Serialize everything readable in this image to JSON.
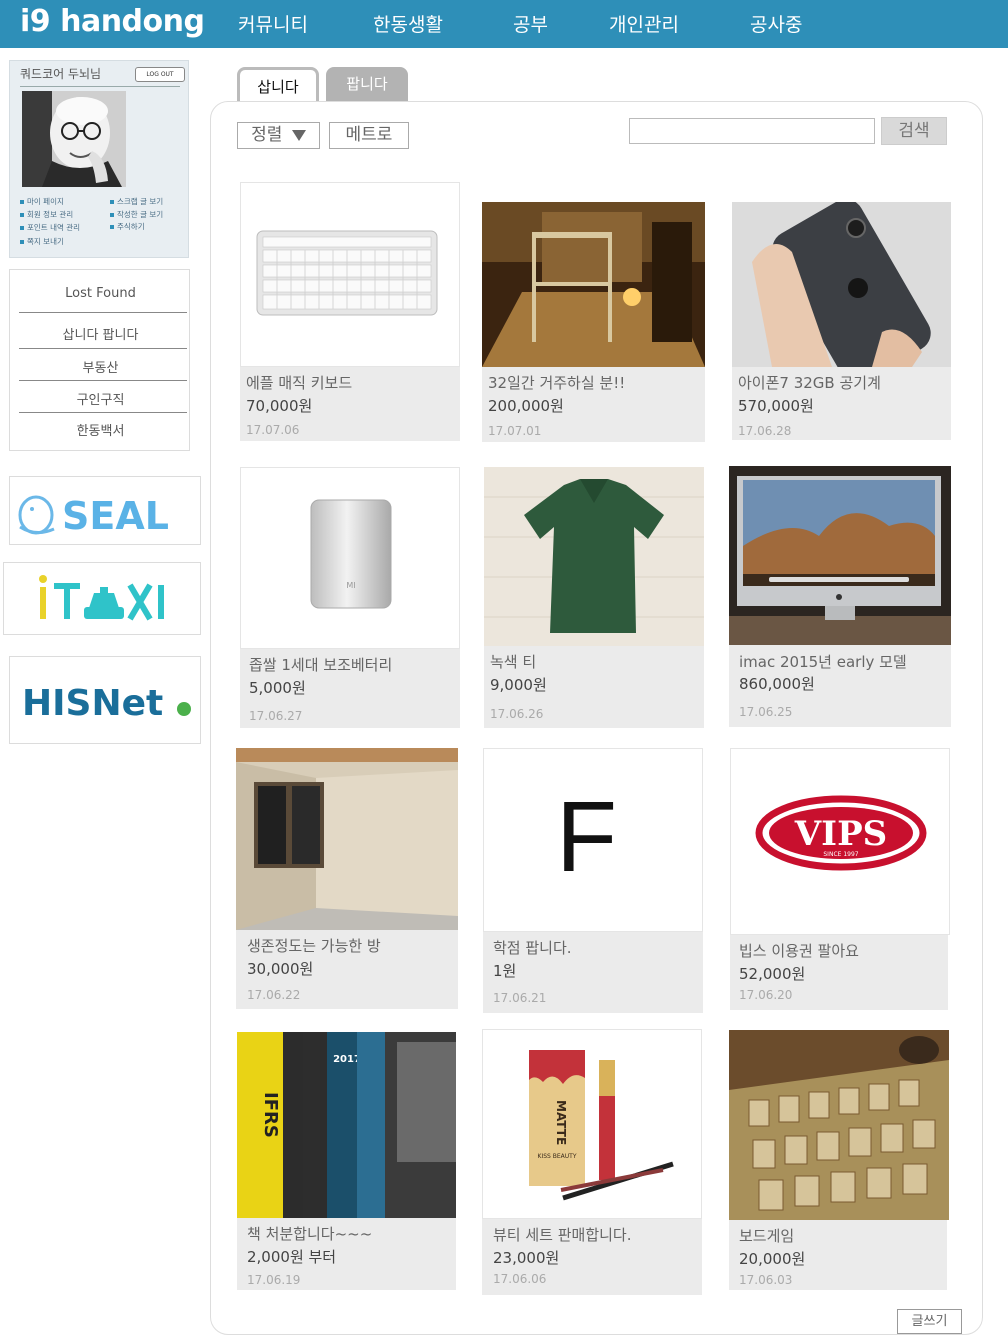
{
  "app": {
    "logo": "i9 handong"
  },
  "nav": [
    "커뮤니티",
    "한동생활",
    "공부",
    "개인관리",
    "공사중"
  ],
  "profile": {
    "nickname": "쿼드코어 두뇌님",
    "logout": "LOG OUT",
    "links_left": [
      "마이 페이지",
      "회원 정보 관리",
      "포인트 내역 관리",
      "쪽지 보내기"
    ],
    "links_right": [
      "스크랩 글 보기",
      "작성한 글 보기",
      "주식하기"
    ]
  },
  "sidemenu": {
    "header": "Lost Found",
    "items": [
      "삽니다 팝니다",
      "부동산",
      "구인구직",
      "한동백서"
    ]
  },
  "banners": [
    "SEAL",
    "iTAXI",
    "HISNet"
  ],
  "tabs": {
    "buy": "삽니다",
    "sell": "팝니다"
  },
  "controls": {
    "sort": "정렬",
    "metro": "메트로",
    "search_button": "검색",
    "search_value": ""
  },
  "products": [
    {
      "title": "에플 매직 키보드",
      "price": "70,000원",
      "date": "17.07.06"
    },
    {
      "title": "32일간 거주하실 분!!",
      "price": "200,000원",
      "date": "17.07.01"
    },
    {
      "title": "아이폰7 32GB 공기계",
      "price": "570,000원",
      "date": "17.06.28"
    },
    {
      "title": "좁쌀 1세대 보조베터리",
      "price": "5,000원",
      "date": "17.06.27"
    },
    {
      "title": "녹색 티",
      "price": "9,000원",
      "date": "17.06.26"
    },
    {
      "title": "imac 2015년 early 모델",
      "price": "860,000원",
      "date": "17.06.25"
    },
    {
      "title": "생존정도는 가능한 방",
      "price": "30,000원",
      "date": "17.06.22"
    },
    {
      "title": "학점 팝니다.",
      "price": "1원",
      "date": "17.06.21"
    },
    {
      "title": "빕스 이용권 팔아요",
      "price": "52,000원",
      "date": "17.06.20"
    },
    {
      "title": "책 처분합니다~~~",
      "price": "2,000원 부터",
      "date": "17.06.19"
    },
    {
      "title": "뷰티 세트 판매합니다.",
      "price": "23,000원",
      "date": "17.06.06"
    },
    {
      "title": "보드게임",
      "price": "20,000원",
      "date": "17.06.03"
    }
  ],
  "image_text": {
    "grade": "F",
    "vips": "VIPS",
    "vips_since": "SINCE 1997",
    "ifrs": "IFRS",
    "matte": "MATTE",
    "kiss_beauty": "KISS BEAUTY",
    "year": "2017",
    "logo_watermark": "MI"
  },
  "write_button": "글쓰기",
  "colors": {
    "brand": "#2e8fb8",
    "card_bg": "#ebebeb"
  }
}
